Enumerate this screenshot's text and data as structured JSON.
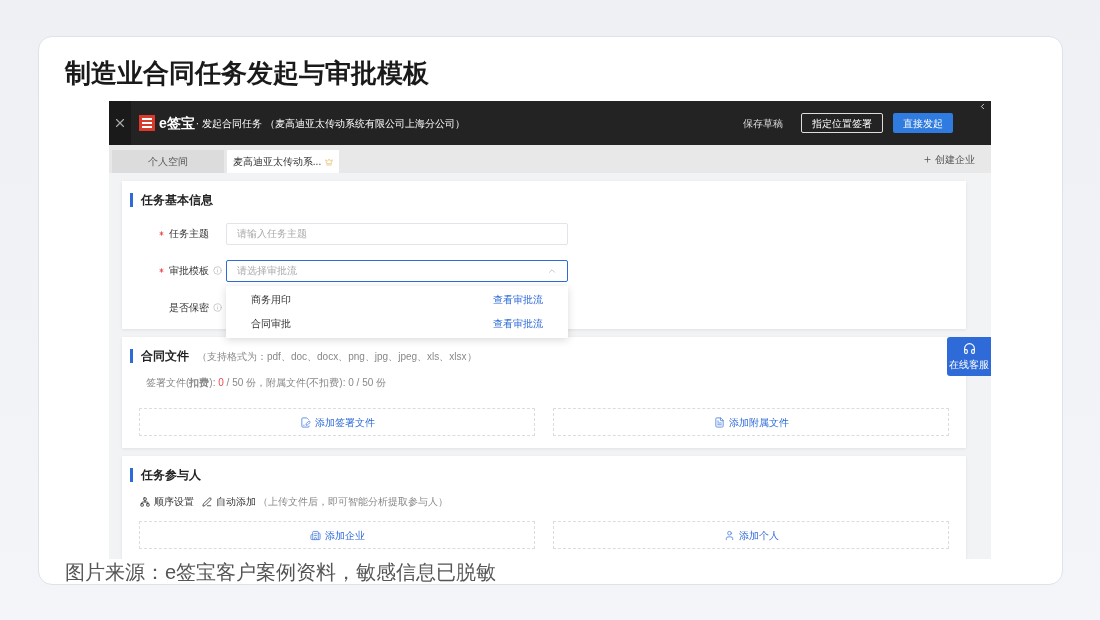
{
  "slide": {
    "title": "制造业合同任务发起与审批模板",
    "caption": "图片来源：e签宝客户案例资料，敏感信息已脱敏"
  },
  "app": {
    "logo_text": "e签宝",
    "title": "· 发起合同任务 （麦高迪亚太传动系统有限公司上海分公司）",
    "actions": [
      {
        "label": "保存草稿",
        "kind": "text"
      },
      {
        "label": "指定位置签署",
        "kind": "outline"
      },
      {
        "label": "直接发起",
        "kind": "primary"
      }
    ],
    "tabs": [
      {
        "label": "个人空间",
        "selected": false,
        "crown": false
      },
      {
        "label": "麦高迪亚太传动系...",
        "selected": true,
        "crown": true
      }
    ],
    "create_company": "创建企业",
    "basic_info": {
      "heading": "任务基本信息",
      "fields": [
        {
          "label": "任务主题",
          "required": true,
          "info": false,
          "kind": "input",
          "placeholder": "请输入任务主题",
          "focused": false
        },
        {
          "label": "审批模板",
          "required": true,
          "info": true,
          "kind": "select",
          "placeholder": "请选择审批流",
          "focused": true
        },
        {
          "label": "是否保密",
          "required": false,
          "info": true,
          "kind": "hidden"
        }
      ],
      "dropdown": [
        {
          "label": "商务用印",
          "link": "查看审批流"
        },
        {
          "label": "合同审批",
          "link": "查看审批流"
        }
      ]
    },
    "files": {
      "heading": "合同文件",
      "formats": "（支持格式为：pdf、doc、docx、png、jpg、jpeg、xls、xlsx）",
      "summary_prefix": "签署文件(**扣费**): ",
      "signed_count": "0",
      "summary_rest": " / 50 份，附属文件(不扣费): 0 / 50 份",
      "add_buttons": [
        {
          "label": "添加签署文件",
          "kind": "sign"
        },
        {
          "label": "添加附属文件",
          "kind": "attach"
        }
      ]
    },
    "participants": {
      "heading": "任务参与人",
      "tools": [
        {
          "label": "顺序设置",
          "kind": "order"
        },
        {
          "label": "自动添加",
          "kind": "auto"
        }
      ],
      "hint": "（上传文件后，即可智能分析提取参与人）",
      "add_buttons": [
        {
          "label": "添加企业",
          "kind": "company"
        },
        {
          "label": "添加个人",
          "kind": "person"
        }
      ]
    },
    "support": "在线客服"
  }
}
